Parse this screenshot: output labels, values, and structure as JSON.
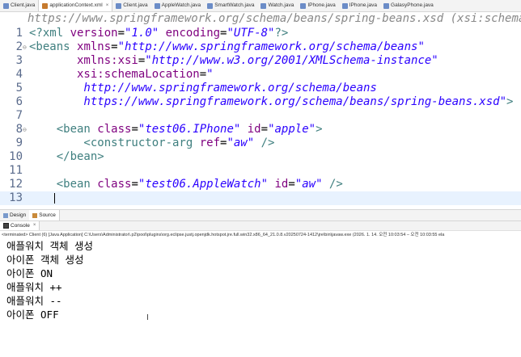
{
  "editor_tabs": [
    {
      "label": "Client.java",
      "color": "#6b8cc7",
      "active": false
    },
    {
      "label": "applicationContext.xml",
      "color": "#c67a2e",
      "active": true
    },
    {
      "label": "Client.java",
      "color": "#6b8cc7",
      "active": false
    },
    {
      "label": "AppleWatch.java",
      "color": "#6b8cc7",
      "active": false
    },
    {
      "label": "SmartWatch.java",
      "color": "#6b8cc7",
      "active": false
    },
    {
      "label": "Watch.java",
      "color": "#6b8cc7",
      "active": false
    },
    {
      "label": "IPhone.java",
      "color": "#6b8cc7",
      "active": false
    },
    {
      "label": "IPhone.java",
      "color": "#6b8cc7",
      "active": false
    },
    {
      "label": "GalasyPhone.java",
      "color": "#6b8cc7",
      "active": false
    }
  ],
  "close_glyph": "×",
  "header_hint": "https://www.springframework.org/schema/beans/spring-beans.xsd (xsi:schemaLocation)",
  "editor": {
    "line_numbers": [
      "1",
      "2",
      "3",
      "4",
      "5",
      "6",
      "7",
      "8",
      "9",
      "10",
      "11",
      "12",
      "13"
    ],
    "lines": [
      [
        {
          "t": "<?xml ",
          "c": "pi"
        },
        {
          "t": "version",
          "c": "attr"
        },
        {
          "t": "=",
          "c": ""
        },
        {
          "t": "\"1.0\"",
          "c": "str"
        },
        {
          "t": " encoding",
          "c": "attr"
        },
        {
          "t": "=",
          "c": ""
        },
        {
          "t": "\"UTF-8\"",
          "c": "str"
        },
        {
          "t": "?>",
          "c": "pi"
        }
      ],
      [
        {
          "t": "<beans ",
          "c": "tag"
        },
        {
          "t": "xmlns",
          "c": "attr"
        },
        {
          "t": "=",
          "c": ""
        },
        {
          "t": "\"http://www.springframework.org/schema/beans\"",
          "c": "str"
        }
      ],
      [
        {
          "t": "       xmlns:xsi",
          "c": "attr"
        },
        {
          "t": "=",
          "c": ""
        },
        {
          "t": "\"http://www.w3.org/2001/XMLSchema-instance\"",
          "c": "str"
        }
      ],
      [
        {
          "t": "       xsi:schemaLocation",
          "c": "attr"
        },
        {
          "t": "=",
          "c": ""
        },
        {
          "t": "\"",
          "c": "str"
        }
      ],
      [
        {
          "t": "        http://www.springframework.org/schema/beans",
          "c": "str"
        }
      ],
      [
        {
          "t": "        https://www.springframework.org/schema/beans/spring-beans.xsd\"",
          "c": "str"
        },
        {
          "t": ">",
          "c": "tag"
        }
      ],
      [],
      [
        {
          "t": "    <bean ",
          "c": "tag"
        },
        {
          "t": "class",
          "c": "attr"
        },
        {
          "t": "=",
          "c": ""
        },
        {
          "t": "\"test06.IPhone\"",
          "c": "str"
        },
        {
          "t": " id",
          "c": "attr"
        },
        {
          "t": "=",
          "c": ""
        },
        {
          "t": "\"apple\"",
          "c": "str"
        },
        {
          "t": ">",
          "c": "tag"
        }
      ],
      [
        {
          "t": "        <constructor-arg ",
          "c": "tag"
        },
        {
          "t": "ref",
          "c": "attr"
        },
        {
          "t": "=",
          "c": ""
        },
        {
          "t": "\"aw\"",
          "c": "str"
        },
        {
          "t": " />",
          "c": "tag"
        }
      ],
      [
        {
          "t": "    </bean>",
          "c": "tag"
        }
      ],
      [],
      [
        {
          "t": "    <bean ",
          "c": "tag"
        },
        {
          "t": "class",
          "c": "attr"
        },
        {
          "t": "=",
          "c": ""
        },
        {
          "t": "\"test06.AppleWatch\"",
          "c": "str"
        },
        {
          "t": " id",
          "c": "attr"
        },
        {
          "t": "=",
          "c": ""
        },
        {
          "t": "\"aw\"",
          "c": "str"
        },
        {
          "t": " />",
          "c": "tag"
        }
      ],
      []
    ],
    "fold_markers": {
      "2": "⊖",
      "8": "⊖"
    }
  },
  "bottom_tabs": [
    {
      "label": "Design",
      "active": false
    },
    {
      "label": "Source",
      "active": true
    }
  ],
  "console": {
    "tab_label": "Console",
    "terminated_text": "<terminated> Client (6) [Java Application] C:\\Users\\Administrator\\.p2\\pool\\plugins\\org.eclipse.justj.openjdk.hotspot.jre.full.win32.x86_64_21.0.8.v20250724-1412\\jre\\bin\\javaw.exe  (2026. 1. 14. 오전 10:03:54 – 오전 10:03:55 ela",
    "output": [
      "애플워치 객체 생성",
      "아이폰 객체 생성",
      "아이폰 ON",
      "애플워치 ++",
      "애플워치 --",
      "아이폰 OFF"
    ]
  },
  "cursor_glyph": "I"
}
